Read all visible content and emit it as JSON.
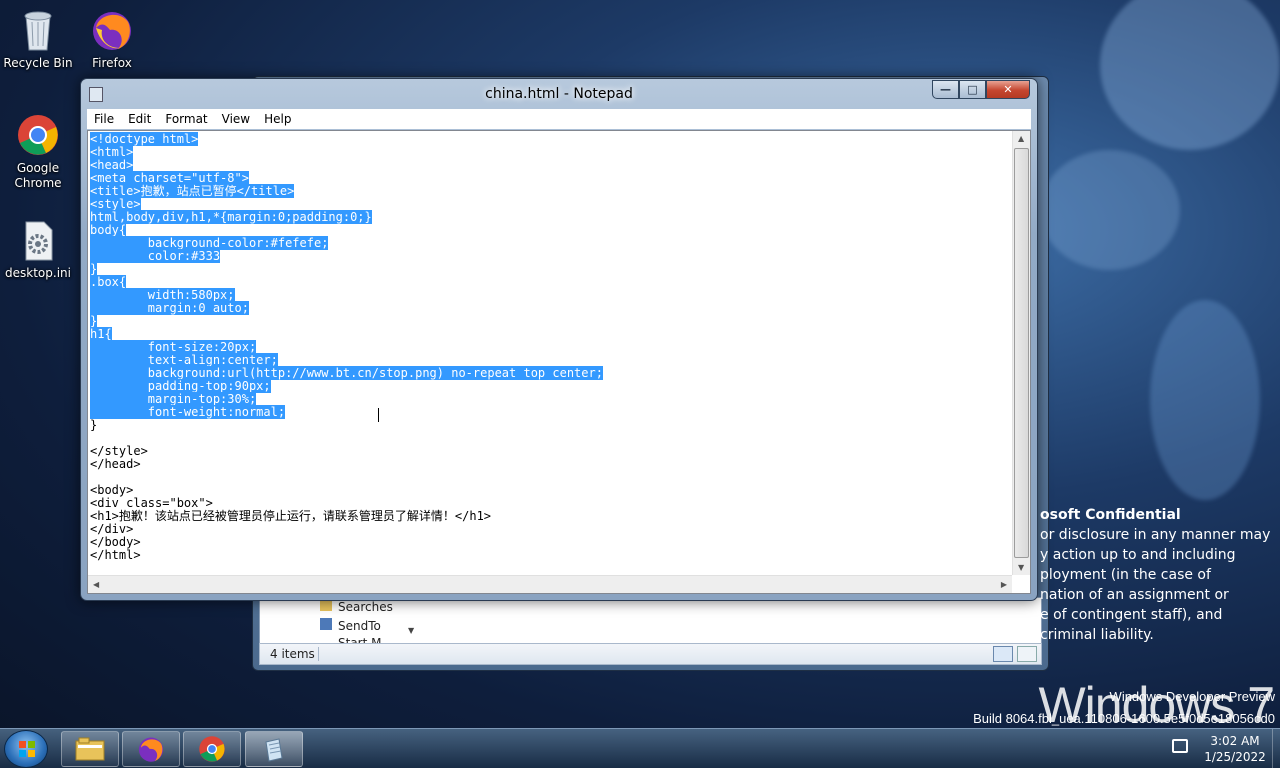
{
  "desktop": {
    "icons": [
      {
        "label": "Recycle Bin"
      },
      {
        "label": "Firefox"
      },
      {
        "label": "Google Chrome"
      },
      {
        "label": "desktop.ini"
      }
    ]
  },
  "explorer": {
    "items": [
      "Searches",
      "SendTo",
      "Start M..."
    ],
    "status": "4 items"
  },
  "notepad": {
    "title": "china.html - Notepad",
    "menu": [
      "File",
      "Edit",
      "Format",
      "View",
      "Help"
    ],
    "lines": [
      {
        "sel": "<!doctype html>",
        "rest": ""
      },
      {
        "sel": "<html>",
        "rest": ""
      },
      {
        "sel": "<head>",
        "rest": ""
      },
      {
        "sel": "<meta charset=\"utf-8\">",
        "rest": ""
      },
      {
        "sel": "<title>抱歉，站点已暂停</title>",
        "rest": ""
      },
      {
        "sel": "<style>",
        "rest": ""
      },
      {
        "sel": "html,body,div,h1,*{margin:0;padding:0;}",
        "rest": ""
      },
      {
        "sel": "body{",
        "rest": ""
      },
      {
        "sel": "\tbackground-color:#fefefe;",
        "rest": ""
      },
      {
        "sel": "\tcolor:#333",
        "rest": ""
      },
      {
        "sel": "}",
        "rest": ""
      },
      {
        "sel": ".box{",
        "rest": ""
      },
      {
        "sel": "\twidth:580px;",
        "rest": ""
      },
      {
        "sel": "\tmargin:0 auto;",
        "rest": ""
      },
      {
        "sel": "}",
        "rest": ""
      },
      {
        "sel": "h1{",
        "rest": ""
      },
      {
        "sel": "\tfont-size:20px;",
        "rest": ""
      },
      {
        "sel": "\ttext-align:center;",
        "rest": ""
      },
      {
        "sel": "\tbackground:url(http://www.bt.cn/stop.png) no-repeat top center;",
        "rest": ""
      },
      {
        "sel": "\tpadding-top:90px;",
        "rest": ""
      },
      {
        "sel": "\tmargin-top:30%;",
        "rest": ""
      },
      {
        "sel": "\tfont-weight:normal;",
        "rest": ""
      },
      {
        "sel": "",
        "rest": "}"
      },
      {
        "sel": "",
        "rest": ""
      },
      {
        "sel": "",
        "rest": "</style>"
      },
      {
        "sel": "",
        "rest": "</head>"
      },
      {
        "sel": "",
        "rest": ""
      },
      {
        "sel": "",
        "rest": "<body>"
      },
      {
        "sel": "",
        "rest": "<div class=\"box\">"
      },
      {
        "sel": "",
        "rest": "<h1>抱歉！该站点已经被管理员停止运行，请联系管理员了解详情！</h1>"
      },
      {
        "sel": "",
        "rest": "</div>"
      },
      {
        "sel": "",
        "rest": "</body>"
      },
      {
        "sel": "",
        "rest": "</html>"
      }
    ]
  },
  "watermark": {
    "title": "osoft Confidential",
    "lines": [
      "or disclosure in any manner may",
      "y action up to and including",
      "ployment (in the case of",
      "nation of an assignment or",
      "e of contingent staff), and",
      "criminal liability."
    ],
    "brand": "Windows 7",
    "build_line1": "Windows Developer Preview",
    "build_line2": "Build 8064.fbl_uea.110806-1600.5e5f0d5e18056cd0"
  },
  "taskbar": {
    "time": "3:02 AM",
    "date": "1/25/2022"
  }
}
